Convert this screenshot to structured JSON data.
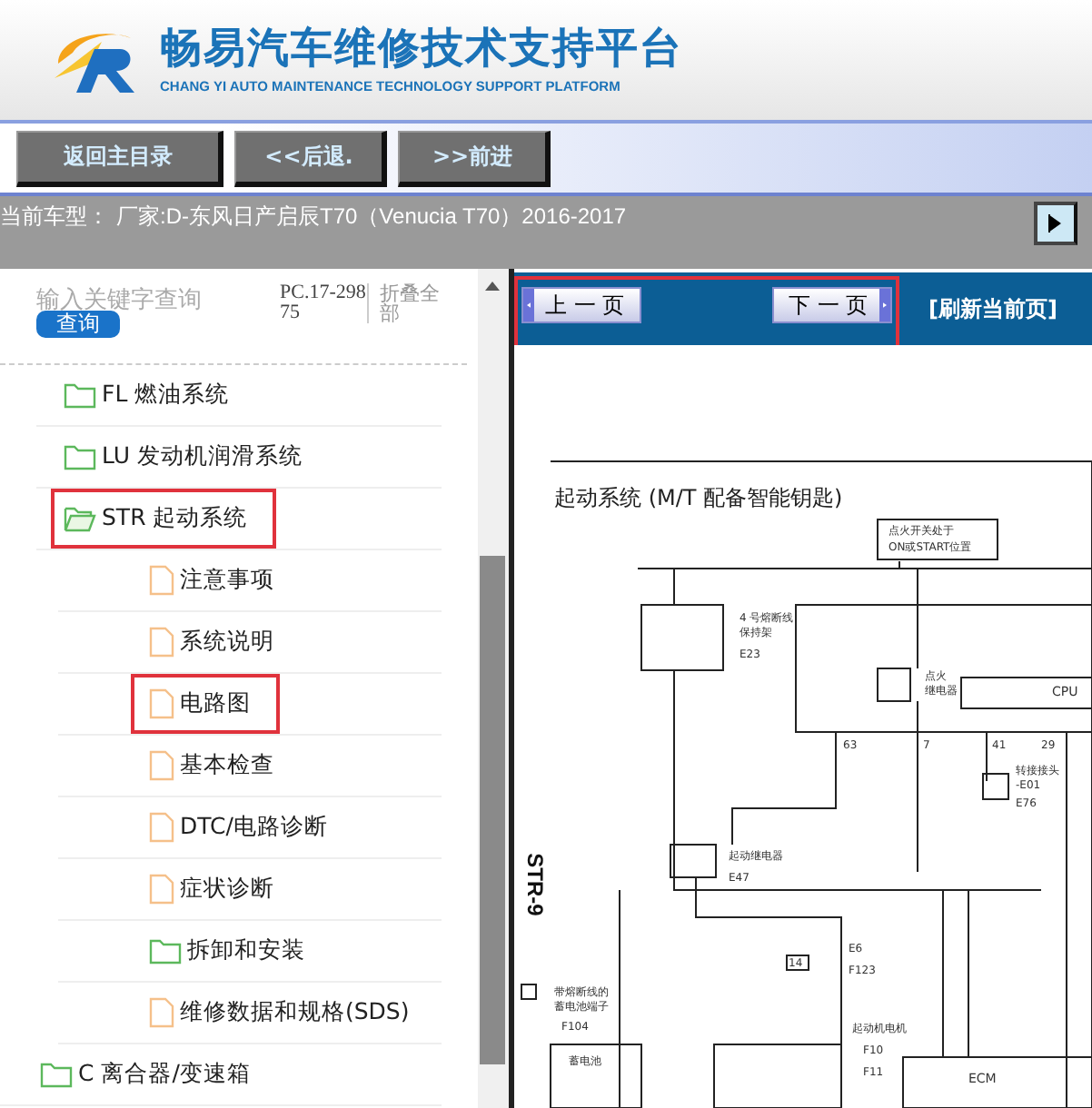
{
  "header": {
    "title": "畅易汽车维修技术支持平台",
    "subtitle": "CHANG YI AUTO MAINTENANCE TECHNOLOGY SUPPORT PLATFORM"
  },
  "toolbar": {
    "buttons": [
      "返回主目录",
      "<<后退.",
      ">>前进"
    ]
  },
  "vehicle_bar": {
    "label": "当前车型：",
    "value": "厂家:D-东风日产启辰T70（Venucia T70）2016-2017"
  },
  "search": {
    "placeholder": "输入关键字查询",
    "button": "查询",
    "code": "PC.17-29875",
    "collapse": "折叠全部"
  },
  "tree": {
    "continued": [
      {
        "label": "FL 燃油系统",
        "kind": "folder",
        "expanded": false,
        "highlighted": false
      },
      {
        "label": "LU 发动机润滑系统",
        "kind": "folder",
        "expanded": false,
        "highlighted": false
      },
      {
        "label": "STR 起动系统",
        "kind": "folder",
        "expanded": true,
        "highlighted": true,
        "children": [
          {
            "label": "注意事项",
            "kind": "file",
            "highlighted": false
          },
          {
            "label": "系统说明",
            "kind": "file",
            "highlighted": false
          },
          {
            "label": "电路图",
            "kind": "file",
            "highlighted": true
          },
          {
            "label": "基本检查",
            "kind": "file",
            "highlighted": false
          },
          {
            "label": "DTC/电路诊断",
            "kind": "file",
            "highlighted": false
          },
          {
            "label": "症状诊断",
            "kind": "file",
            "highlighted": false
          },
          {
            "label": "拆卸和安装",
            "kind": "folder",
            "expanded": false,
            "highlighted": false
          },
          {
            "label": "维修数据和规格(SDS)",
            "kind": "file",
            "highlighted": false
          }
        ]
      }
    ],
    "items": [
      {
        "label": "C 离合器/变速箱",
        "kind": "folder",
        "expanded": false,
        "highlighted": false
      }
    ]
  },
  "page_nav": {
    "prev": "上 一 页",
    "next": "下 一 页",
    "refresh": "[刷新当前页]",
    "highlighted": true
  },
  "document": {
    "page_label": "STR-9",
    "title": "起动系统 (M/T 配备智能钥匙)",
    "labels": [
      "点火开关处于",
      "ON或START位置",
      "4 号熔断线",
      "保持架",
      "E23",
      "点火",
      "继电器",
      "CPU",
      "63",
      "7",
      "41",
      "29",
      "转接接头",
      "-E01",
      "E76",
      "起动继电器",
      "E47",
      "E6",
      "14",
      "F123",
      "带熔断线的",
      "蓄电池端子",
      "F104",
      "起动机电机",
      "F10",
      "蓄电池",
      "F11",
      "ECM"
    ]
  }
}
